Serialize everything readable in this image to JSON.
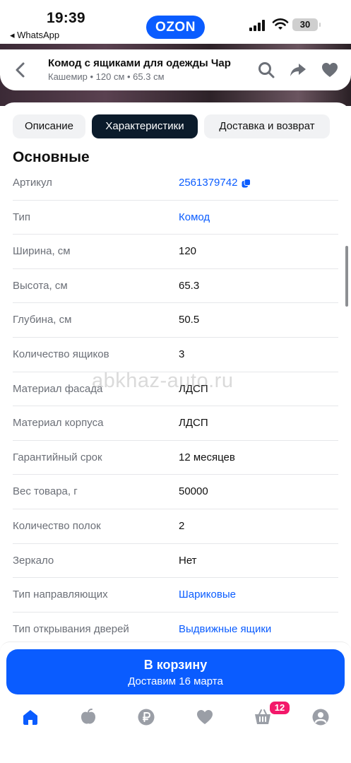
{
  "status_bar": {
    "time": "19:39",
    "back_app": "◂ WhatsApp",
    "brand_logo": "OZON",
    "battery": "30",
    "icons": [
      "signal-icon",
      "wifi-icon",
      "battery-icon"
    ]
  },
  "header": {
    "title": "Комод с ящиками для одежды Чар",
    "subtitle": "Кашемир • 120 см • 65.3 см",
    "icons": [
      "back-arrow-icon",
      "search-icon",
      "share-icon",
      "heart-icon"
    ]
  },
  "tabs": [
    {
      "label": "Описание",
      "active": false
    },
    {
      "label": "Характеристики",
      "active": true
    },
    {
      "label": "Доставка и возврат",
      "active": false
    }
  ],
  "section": {
    "title": "Основные",
    "rows": [
      {
        "key": "Артикул",
        "value": "2561379742",
        "link": true
      },
      {
        "key": "Тип",
        "value": "Комод",
        "link": true
      },
      {
        "key": "Ширина, см",
        "value": "120",
        "link": false
      },
      {
        "key": "Высота, см",
        "value": "65.3",
        "link": false
      },
      {
        "key": "Глубина, см",
        "value": "50.5",
        "link": false
      },
      {
        "key": "Количество ящиков",
        "value": "3",
        "link": false
      },
      {
        "key": "Материал фасада",
        "value": "ЛДСП",
        "link": false
      },
      {
        "key": "Материал корпуса",
        "value": "ЛДСП",
        "link": false
      },
      {
        "key": "Гарантийный срок",
        "value": "12 месяцев",
        "link": false
      },
      {
        "key": "Вес товара, г",
        "value": "50000",
        "link": false
      },
      {
        "key": "Количество полок",
        "value": "2",
        "link": false
      },
      {
        "key": "Зеркало",
        "value": "Нет",
        "link": false
      },
      {
        "key": "Тип направляющих",
        "value": "Шариковые",
        "link": true
      },
      {
        "key": "Тип открывания дверей",
        "value": "Выдвижные ящики",
        "link": true
      }
    ]
  },
  "watermark": "abkhaz-auto.ru",
  "cart_button": {
    "label": "В корзину",
    "delivery": "Доставим 16 марта"
  },
  "bottom_nav": {
    "items": [
      "home-icon",
      "fresh-icon",
      "ruble-icon",
      "favorites-icon",
      "cart-icon",
      "profile-icon"
    ],
    "cart_badge": "12"
  },
  "colors": {
    "accent": "#0a5cff",
    "active_tab": "#0b1b2b",
    "badge": "#f3186a",
    "muted_text": "#6b6f77"
  }
}
